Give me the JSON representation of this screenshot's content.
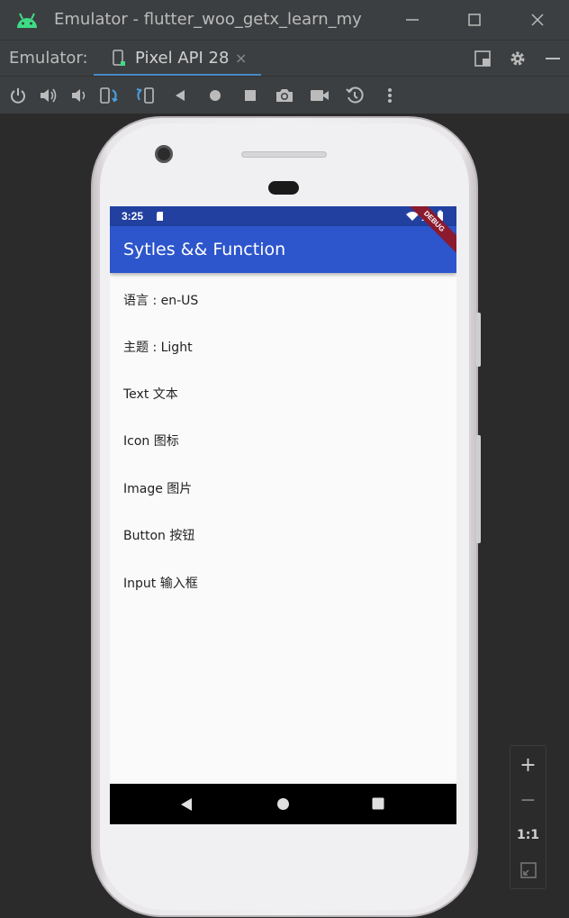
{
  "window": {
    "title": "Emulator - flutter_woo_getx_learn_my"
  },
  "tabbar": {
    "label": "Emulator:",
    "device_tab": "Pixel API 28",
    "close_glyph": "×"
  },
  "device": {
    "status_time": "3:25",
    "debug_banner": "DEBUG",
    "app_title": "Sytles && Function",
    "items": [
      "语言 : en-US",
      "主题 : Light",
      "Text 文本",
      "Icon 图标",
      "Image 图片",
      "Button 按钮",
      "Input 输入框"
    ]
  },
  "zoom": {
    "plus": "+",
    "minus": "−",
    "one_to_one": "1:1"
  },
  "colors": {
    "status_bar": "#2240a0",
    "app_bar": "#2d55cc",
    "debug_banner": "#8b1a2f",
    "tab_underline": "#4a88c7",
    "ide_background": "#2b2b2b",
    "ide_chrome": "#3c3f41"
  }
}
